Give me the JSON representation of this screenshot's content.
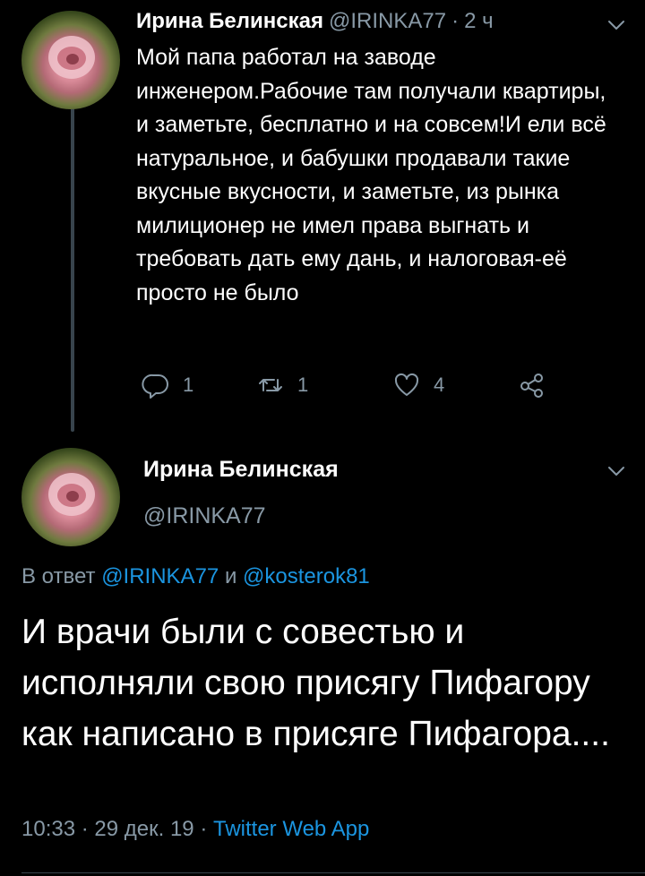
{
  "tweet1": {
    "author_name": "Ирина Белинская",
    "author_handle": "@IRINKA77",
    "separator": "·",
    "time": "2 ч",
    "text": "Мой папа работал на заводе инженером.Рабочие там получали квартиры, и заметьте, бесплатно и на совсем!И ели всё натуральное, и бабушки продавали такие вкусные вкусности, и заметьте, из рынка милиционер не имел права выгнать и требовать дать ему дань, и налоговая-её просто не было",
    "reply_count": "1",
    "retweet_count": "1",
    "like_count": "4"
  },
  "tweet2": {
    "author_name": "Ирина Белинская",
    "author_handle": "@IRINKA77",
    "reply_prefix": "В ответ",
    "reply_user1": "@IRINKA77",
    "reply_conj": "и",
    "reply_user2": "@kosterok81",
    "text": "И врачи были с совестью и исполняли свою присягу Пифагору как написано в присяге Пифагора....",
    "time": "10:33",
    "date": "29 дек. 19",
    "separator": "·",
    "app": "Twitter Web App"
  },
  "icons": {
    "reply": "reply-icon",
    "retweet": "retweet-icon",
    "like": "heart-icon",
    "share": "share-icon",
    "menu": "chevron-down-icon"
  },
  "colors": {
    "background": "#000000",
    "text": "#ffffff",
    "secondary": "#8899a6",
    "link": "#1b95e0",
    "line": "#38444d"
  }
}
